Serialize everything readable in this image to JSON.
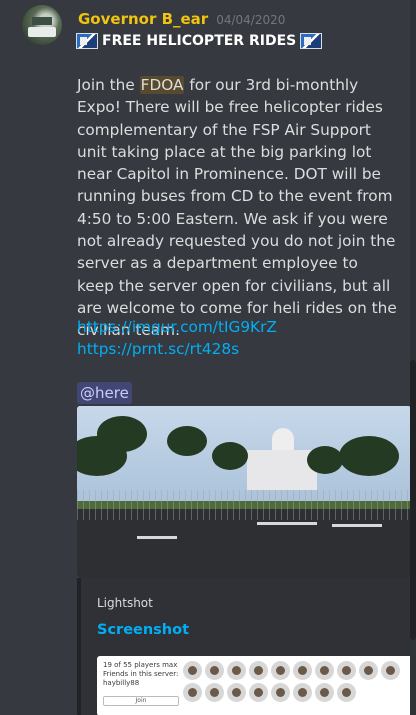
{
  "message": {
    "username": "Governor B_ear",
    "timestamp": "04/04/2020",
    "title": "FREE HELICOPTER RIDES",
    "title_emoji": "fk-badge-icon",
    "body_pre": "Join the ",
    "body_highlight": "FDOA",
    "body_post": " for our 3rd bi-monthly Expo! There will be free helicopter rides complementary of the FSP Air Support unit taking place at the big parking lot near Capitol in Prominence. DOT will be running buses from CD to the event from 4:50 to 5:00 Eastern. We ask if you were not already requested you do not join the server as a department employee to keep the server open for civilians, but all are welcome to come for heli rides on the civilian team.",
    "links": [
      "https://imgur.com/tIG9KrZ",
      "https://prnt.sc/rt428s"
    ],
    "mention": "@here"
  },
  "embed": {
    "provider": "Lightshot",
    "title": "Screenshot",
    "thumb_line1": "19 of 55 players max",
    "thumb_line2": "Friends in this server: haybilly88",
    "join": "Join"
  },
  "colors": {
    "username": "#f1c40f",
    "link": "#00aff4",
    "background": "#36393f",
    "embed_bg": "#2f3136"
  }
}
